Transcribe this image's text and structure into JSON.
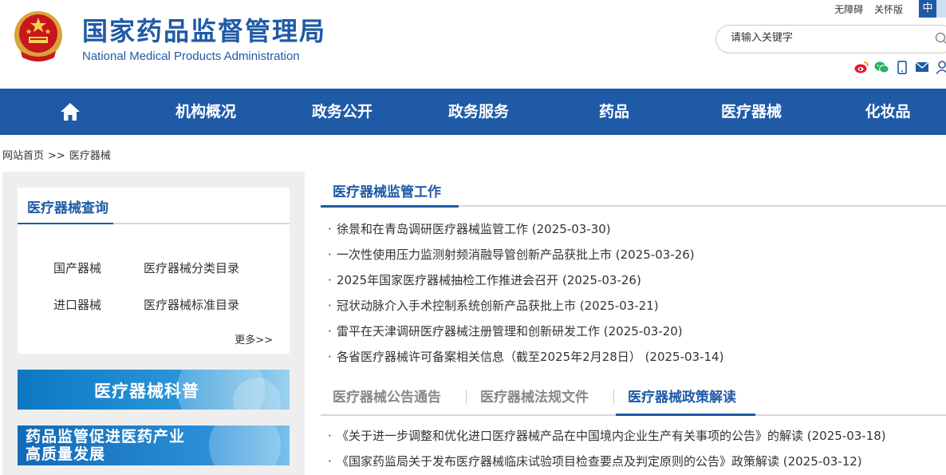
{
  "header": {
    "title_cn": "国家药品监督管理局",
    "title_en": "National Medical Products Administration",
    "accessibility": "无障碍",
    "care_mode": "关怀版",
    "lang_current": "中",
    "search_placeholder": "请输入关键字"
  },
  "nav": {
    "home_icon": "home-icon",
    "items": [
      "机构概况",
      "政务公开",
      "政务服务",
      "药品",
      "医疗器械",
      "化妆品"
    ]
  },
  "breadcrumb": {
    "home": "网站首页",
    "sep": ">>",
    "current": "医疗器械"
  },
  "sidebar": {
    "query_title": "医疗器械查询",
    "links": [
      "国产器械",
      "医疗器械分类目录",
      "进口器械",
      "医疗器械标准目录"
    ],
    "more": "更多>>",
    "banner1": "医疗器械科普",
    "banner2_line1": "药品监管促进医药产业",
    "banner2_line2": "高质量发展"
  },
  "main": {
    "section_title": "医疗器械监管工作",
    "news": [
      "徐景和在青岛调研医疗器械监管工作 (2025-03-30)",
      "一次性使用压力监测射频消融导管创新产品获批上市 (2025-03-26)",
      "2025年国家医疗器械抽检工作推进会召开 (2025-03-26)",
      "冠状动脉介入手术控制系统创新产品获批上市 (2025-03-21)",
      "雷平在天津调研医疗器械注册管理和创新研发工作 (2025-03-20)",
      "各省医疗器械许可备案相关信息（截至2025年2月28日） (2025-03-14)"
    ],
    "bullet": "·",
    "tabs": [
      "医疗器械公告通告",
      "医疗器械法规文件",
      "医疗器械政策解读"
    ],
    "policy_news": [
      "《关于进一步调整和优化进口医疗器械产品在中国境内企业生产有关事项的公告》的解读 (2025-03-18)",
      "《国家药监局关于发布医疗器械临床试验项目检查要点及判定原则的公告》政策解读 (2025-03-12)"
    ]
  },
  "colors": {
    "brand": "#1f5aa6",
    "sidebar_bg": "#eeeeee",
    "divider": "#d7d7d7"
  }
}
